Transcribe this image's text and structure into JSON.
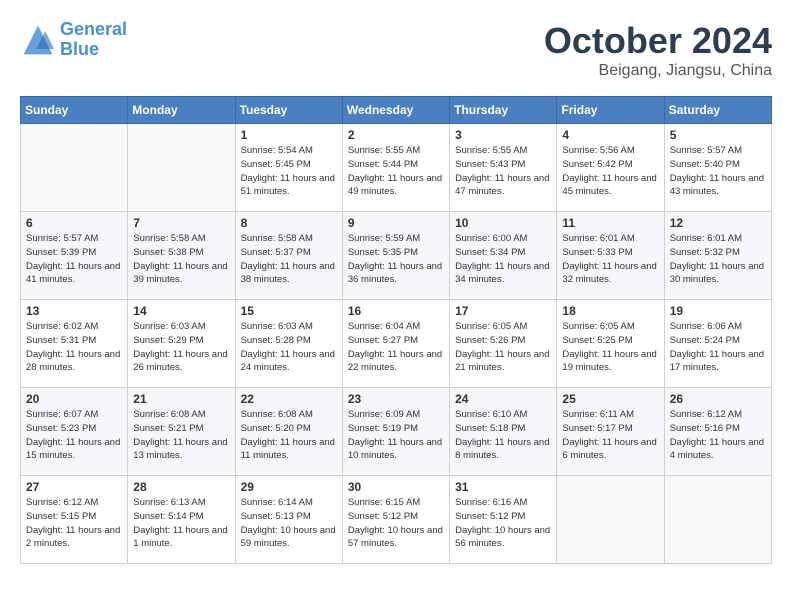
{
  "header": {
    "logo_line1": "General",
    "logo_line2": "Blue",
    "month": "October 2024",
    "location": "Beigang, Jiangsu, China"
  },
  "weekdays": [
    "Sunday",
    "Monday",
    "Tuesday",
    "Wednesday",
    "Thursday",
    "Friday",
    "Saturday"
  ],
  "weeks": [
    [
      {
        "day": "",
        "info": ""
      },
      {
        "day": "",
        "info": ""
      },
      {
        "day": "1",
        "info": "Sunrise: 5:54 AM\nSunset: 5:45 PM\nDaylight: 11 hours\nand 51 minutes."
      },
      {
        "day": "2",
        "info": "Sunrise: 5:55 AM\nSunset: 5:44 PM\nDaylight: 11 hours\nand 49 minutes."
      },
      {
        "day": "3",
        "info": "Sunrise: 5:55 AM\nSunset: 5:43 PM\nDaylight: 11 hours\nand 47 minutes."
      },
      {
        "day": "4",
        "info": "Sunrise: 5:56 AM\nSunset: 5:42 PM\nDaylight: 11 hours\nand 45 minutes."
      },
      {
        "day": "5",
        "info": "Sunrise: 5:57 AM\nSunset: 5:40 PM\nDaylight: 11 hours\nand 43 minutes."
      }
    ],
    [
      {
        "day": "6",
        "info": "Sunrise: 5:57 AM\nSunset: 5:39 PM\nDaylight: 11 hours\nand 41 minutes."
      },
      {
        "day": "7",
        "info": "Sunrise: 5:58 AM\nSunset: 5:38 PM\nDaylight: 11 hours\nand 39 minutes."
      },
      {
        "day": "8",
        "info": "Sunrise: 5:58 AM\nSunset: 5:37 PM\nDaylight: 11 hours\nand 38 minutes."
      },
      {
        "day": "9",
        "info": "Sunrise: 5:59 AM\nSunset: 5:35 PM\nDaylight: 11 hours\nand 36 minutes."
      },
      {
        "day": "10",
        "info": "Sunrise: 6:00 AM\nSunset: 5:34 PM\nDaylight: 11 hours\nand 34 minutes."
      },
      {
        "day": "11",
        "info": "Sunrise: 6:01 AM\nSunset: 5:33 PM\nDaylight: 11 hours\nand 32 minutes."
      },
      {
        "day": "12",
        "info": "Sunrise: 6:01 AM\nSunset: 5:32 PM\nDaylight: 11 hours\nand 30 minutes."
      }
    ],
    [
      {
        "day": "13",
        "info": "Sunrise: 6:02 AM\nSunset: 5:31 PM\nDaylight: 11 hours\nand 28 minutes."
      },
      {
        "day": "14",
        "info": "Sunrise: 6:03 AM\nSunset: 5:29 PM\nDaylight: 11 hours\nand 26 minutes."
      },
      {
        "day": "15",
        "info": "Sunrise: 6:03 AM\nSunset: 5:28 PM\nDaylight: 11 hours\nand 24 minutes."
      },
      {
        "day": "16",
        "info": "Sunrise: 6:04 AM\nSunset: 5:27 PM\nDaylight: 11 hours\nand 22 minutes."
      },
      {
        "day": "17",
        "info": "Sunrise: 6:05 AM\nSunset: 5:26 PM\nDaylight: 11 hours\nand 21 minutes."
      },
      {
        "day": "18",
        "info": "Sunrise: 6:05 AM\nSunset: 5:25 PM\nDaylight: 11 hours\nand 19 minutes."
      },
      {
        "day": "19",
        "info": "Sunrise: 6:06 AM\nSunset: 5:24 PM\nDaylight: 11 hours\nand 17 minutes."
      }
    ],
    [
      {
        "day": "20",
        "info": "Sunrise: 6:07 AM\nSunset: 5:23 PM\nDaylight: 11 hours\nand 15 minutes."
      },
      {
        "day": "21",
        "info": "Sunrise: 6:08 AM\nSunset: 5:21 PM\nDaylight: 11 hours\nand 13 minutes."
      },
      {
        "day": "22",
        "info": "Sunrise: 6:08 AM\nSunset: 5:20 PM\nDaylight: 11 hours\nand 11 minutes."
      },
      {
        "day": "23",
        "info": "Sunrise: 6:09 AM\nSunset: 5:19 PM\nDaylight: 11 hours\nand 10 minutes."
      },
      {
        "day": "24",
        "info": "Sunrise: 6:10 AM\nSunset: 5:18 PM\nDaylight: 11 hours\nand 8 minutes."
      },
      {
        "day": "25",
        "info": "Sunrise: 6:11 AM\nSunset: 5:17 PM\nDaylight: 11 hours\nand 6 minutes."
      },
      {
        "day": "26",
        "info": "Sunrise: 6:12 AM\nSunset: 5:16 PM\nDaylight: 11 hours\nand 4 minutes."
      }
    ],
    [
      {
        "day": "27",
        "info": "Sunrise: 6:12 AM\nSunset: 5:15 PM\nDaylight: 11 hours\nand 2 minutes."
      },
      {
        "day": "28",
        "info": "Sunrise: 6:13 AM\nSunset: 5:14 PM\nDaylight: 11 hours\nand 1 minute."
      },
      {
        "day": "29",
        "info": "Sunrise: 6:14 AM\nSunset: 5:13 PM\nDaylight: 10 hours\nand 59 minutes."
      },
      {
        "day": "30",
        "info": "Sunrise: 6:15 AM\nSunset: 5:12 PM\nDaylight: 10 hours\nand 57 minutes."
      },
      {
        "day": "31",
        "info": "Sunrise: 6:16 AM\nSunset: 5:12 PM\nDaylight: 10 hours\nand 56 minutes."
      },
      {
        "day": "",
        "info": ""
      },
      {
        "day": "",
        "info": ""
      }
    ]
  ]
}
